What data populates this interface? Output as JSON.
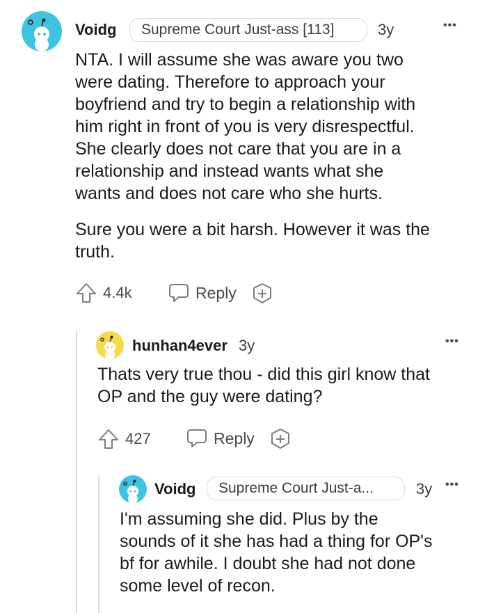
{
  "comments": [
    {
      "username": "Voidg",
      "flair": "Supreme Court Just-ass [113]",
      "age": "3y",
      "more": "•••",
      "paragraphs": [
        "NTA. I will assume she was aware you two",
        "were dating. Therefore to approach your",
        "boyfriend and try to begin a relationship with",
        "him right in front of you is very disrespectful.",
        "She clearly does not care that you are in a",
        "relationship and instead wants what she",
        "wants and does not care who she hurts."
      ],
      "paragraph2": [
        "Sure you were a bit harsh. However it was the",
        "truth."
      ],
      "votes": "4.4k",
      "reply_label": "Reply",
      "avatar_color": "#3cc4e0"
    },
    {
      "username": "hunhan4ever",
      "age": "3y",
      "more": "•••",
      "paragraphs": [
        "Thats very true thou - did this girl know that",
        "OP and the guy were dating?"
      ],
      "votes": "427",
      "reply_label": "Reply",
      "avatar_color": "#f7d94c"
    },
    {
      "username": "Voidg",
      "flair": "Supreme Court Just-a...",
      "age": "3y",
      "more": "•••",
      "paragraphs": [
        "I'm assuming she did. Plus by the",
        "sounds of it she has had a thing for OP's",
        "bf for awhile. I doubt she had not done",
        "some level of recon."
      ],
      "avatar_color": "#3cc4e0"
    }
  ],
  "icons": {
    "upvote": "upvote-arrow-icon",
    "reply": "speech-bubble-icon",
    "award": "plus-award-icon",
    "avatar": "snoo-avatar-icon"
  }
}
